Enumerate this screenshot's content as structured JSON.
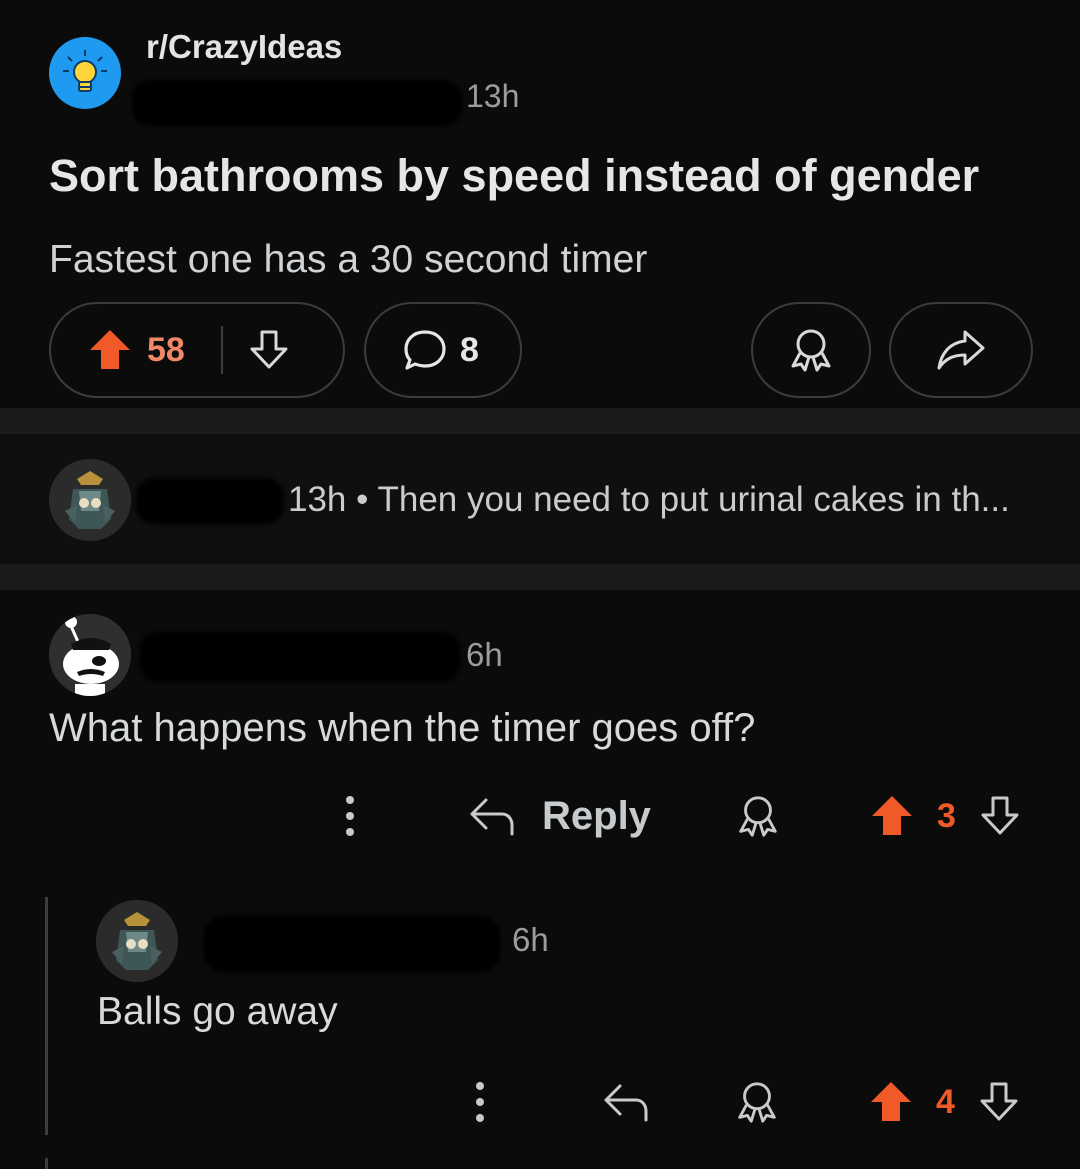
{
  "post": {
    "subreddit": "r/CrazyIdeas",
    "time": "13h",
    "title": "Sort bathrooms by speed instead of gender",
    "body": "Fastest one has a 30 second timer",
    "upvotes": "58",
    "comments": "8",
    "icon": "lightbulb-icon"
  },
  "collapsed_comment": {
    "time": "13h",
    "preview": "Then you need to put urinal cakes in th..."
  },
  "comment1": {
    "time": "6h",
    "body": "What happens when the timer goes off?",
    "reply_label": "Reply",
    "votes": "3"
  },
  "comment2": {
    "time": "6h",
    "body": "Balls go away",
    "votes": "4"
  },
  "colors": {
    "upvote": "#f05a28",
    "background": "#0b0b0b",
    "subreddit_icon": "#1e9bf0"
  }
}
